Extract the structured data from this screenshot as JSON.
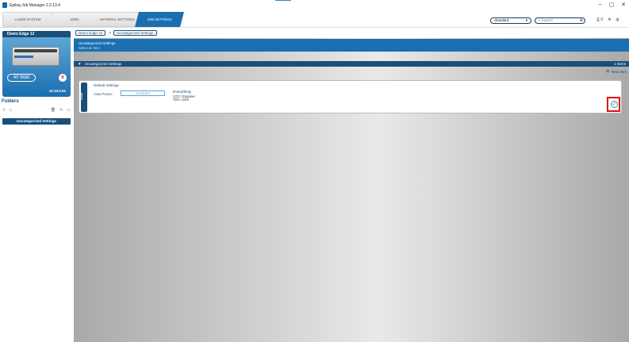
{
  "window": {
    "title": "Epilog Job Manager 2.2.13.4",
    "controls": [
      "–",
      "▢",
      "✕"
    ]
  },
  "tabs": [
    {
      "label": "LASER SYSTEM"
    },
    {
      "label": "JOBS"
    },
    {
      "label": "MATERIAL SETTINGS"
    },
    {
      "label": "JOB SETTINGS",
      "active": true
    }
  ],
  "toolbar": {
    "view_select": "Standard",
    "search_placeholder": "Search",
    "notifications_count": "0"
  },
  "device": {
    "name": "Demo Edge 12",
    "wattage": "40 Watt",
    "ip": "10.10.0.61",
    "status_icon": "x",
    "colors": {
      "primary": "#1a6fb0",
      "dark": "#1a4f7a",
      "error": "#c62828"
    }
  },
  "folders": {
    "label": "Folders",
    "items": [
      {
        "label": "Uncategorized Settings",
        "selected": true
      }
    ]
  },
  "breadcrumb": {
    "items": [
      "Demo Edge 12",
      "Uncategorized Settings"
    ],
    "separator": ">"
  },
  "section": {
    "title": "Uncategorized Settings",
    "subtitle": "Select an Item"
  },
  "group": {
    "label": "Uncategorized Settings",
    "count": "1 Items",
    "new_item_label": "New Item"
  },
  "setting": {
    "side_label": "CO2",
    "title": "Default Settings",
    "auto_focus_label": "Auto Focus:",
    "auto_focus_value": "Disabled",
    "name": "Everything",
    "mode": "CO2 / Engrave",
    "power_speed": "75% / 25%"
  }
}
